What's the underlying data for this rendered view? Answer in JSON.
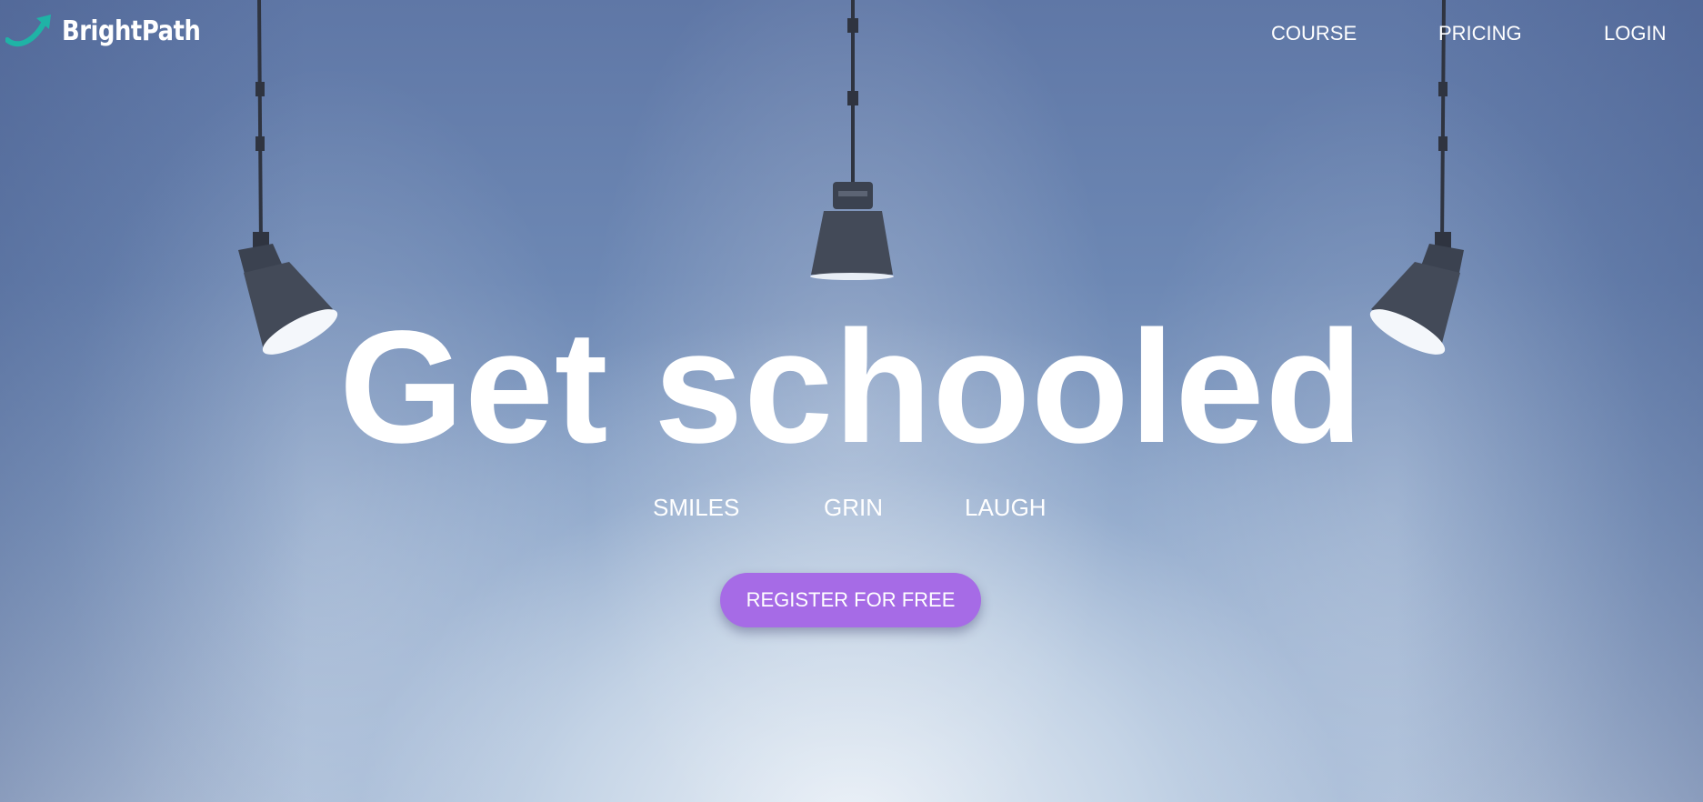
{
  "brand": {
    "name": "BrightPath",
    "logo_icon": "arrow-swoosh-icon",
    "logo_color": "#1fb3a6"
  },
  "nav": {
    "links": [
      {
        "label": "COURSE"
      },
      {
        "label": "PRICING"
      },
      {
        "label": "LOGIN"
      }
    ]
  },
  "hero": {
    "title": "Get schooled",
    "subtitles": [
      "SMILES",
      "GRIN",
      "LAUGH"
    ],
    "cta_label": "REGISTER FOR FREE",
    "cta_color": "#a66be6"
  }
}
